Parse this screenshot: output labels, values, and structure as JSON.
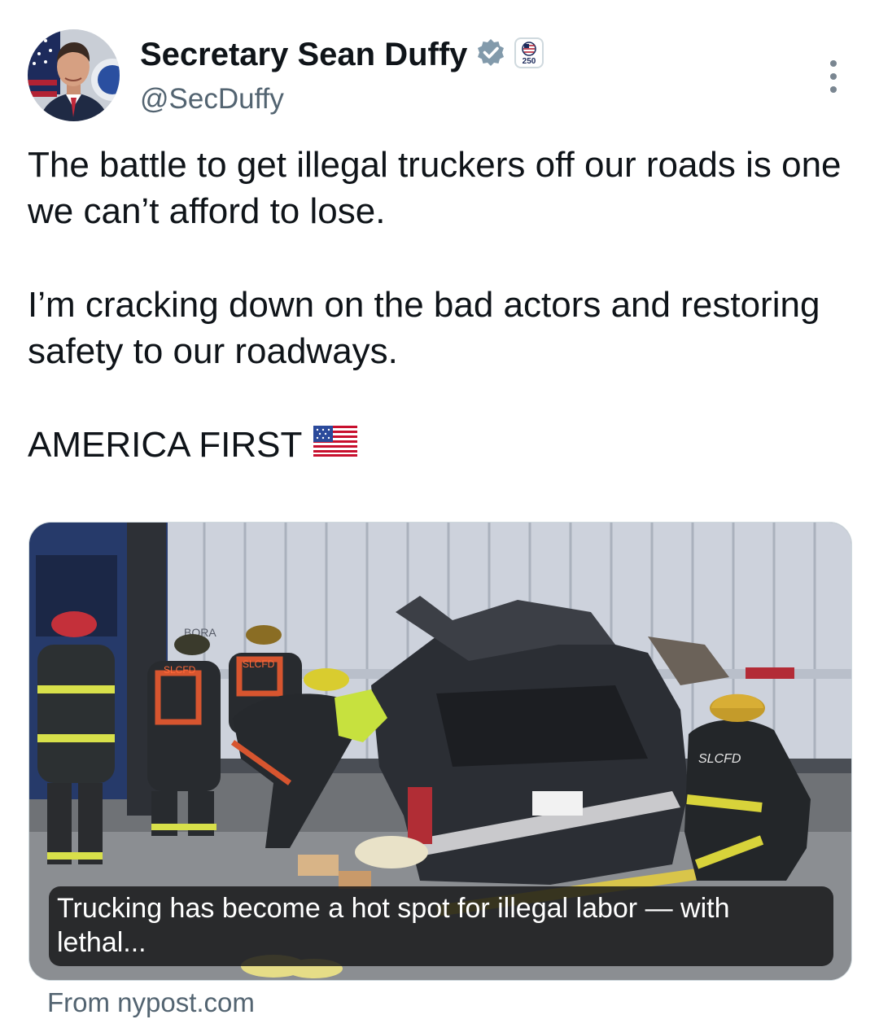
{
  "author": {
    "display_name": "Secretary Sean Duffy",
    "handle": "@SecDuffy",
    "verified_icon": "verified-badge-icon",
    "affiliation_badge_text": "250"
  },
  "tweet": {
    "paragraph_1": "The battle to get illegal truckers off our roads is one we can’t afford to lose.",
    "paragraph_2": "I’m cracking down on the bad actors and restoring safety to our roadways.",
    "paragraph_3": "AMERICA FIRST",
    "flag_emoji_icon": "us-flag-icon"
  },
  "card": {
    "caption": "Trucking has become a hot spot for illegal labor — with lethal...",
    "source": "From nypost.com",
    "image_labels": {
      "trailer_mark": "BORA",
      "vest_1": "SLCFD",
      "vest_2": "SLCFD",
      "jacket_back": "SLCFD"
    }
  },
  "colors": {
    "text_primary": "#0f1419",
    "text_secondary": "#536471",
    "verified_badge": "#829aab"
  }
}
